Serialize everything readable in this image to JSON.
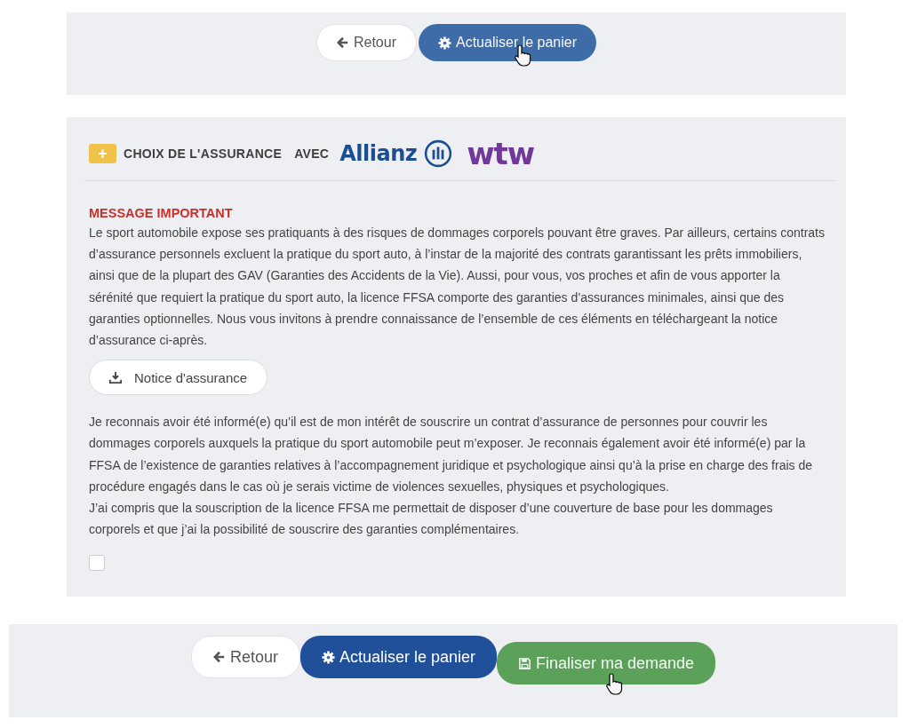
{
  "top_bar": {
    "buttons": [
      {
        "kind": "back",
        "label": "Retour",
        "hovered": false
      },
      {
        "kind": "update",
        "label": "Actualiser le panier",
        "hovered": true
      }
    ]
  },
  "insurance": {
    "badge": "+",
    "title": "CHOIX DE L'ASSURANCE",
    "with": "AVEC",
    "logos": [
      "Allianz",
      "wtw"
    ],
    "message_title": "MESSAGE IMPORTANT",
    "message": "Le sport automobile expose ses pratiquants à des risques de dommages corporels pouvant être graves. Par ailleurs, certains contrats d’assurance personnels excluent la pratique du sport auto, à l’instar de la majorité des contrats garantissant les prêts immobiliers, ainsi que de la plupart des GAV (Garanties des Accidents de la Vie). Aussi, pour vous, vos proches et afin de vous apporter la sérénité que requiert la pratique du sport auto, la licence FFSA comporte des garanties d’assurances minimales, ainsi que des garanties optionnelles. Nous vous invitons à prendre connaissance de l’ensemble de ces éléments en téléchargeant la notice d’assurance ci-après.",
    "download_button": "Notice d'assurance",
    "paragraphs": [
      "Je reconnais avoir été informé(e) qu’il est de mon intérêt de souscrire un contrat d’assurance de personnes pour couvrir les dommages corporels auxquels la pratique du sport automobile peut m’exposer. Je reconnais également avoir été informé(e) par la FFSA de l’existence de garanties relatives à l’accompagnement juridique et psychologique ainsi qu’à la prise en charge des frais de procédure engagés dans le cas où je serais victime de violences sexuelles, physiques et psychologiques.",
      "J’ai compris que la souscription de la licence FFSA me permettait de disposer d’une couverture de base pour les dommages corporels et que j’ai la possibilité de souscrire des garanties complémentaires."
    ],
    "checkbox": {
      "checked": false
    }
  },
  "bottom_bar": {
    "buttons": [
      {
        "kind": "back",
        "label": "Retour",
        "hovered": false
      },
      {
        "kind": "update",
        "label": "Actualiser le panier",
        "hovered": false
      },
      {
        "kind": "finish",
        "label": "Finaliser ma demande",
        "hovered": true
      }
    ]
  }
}
